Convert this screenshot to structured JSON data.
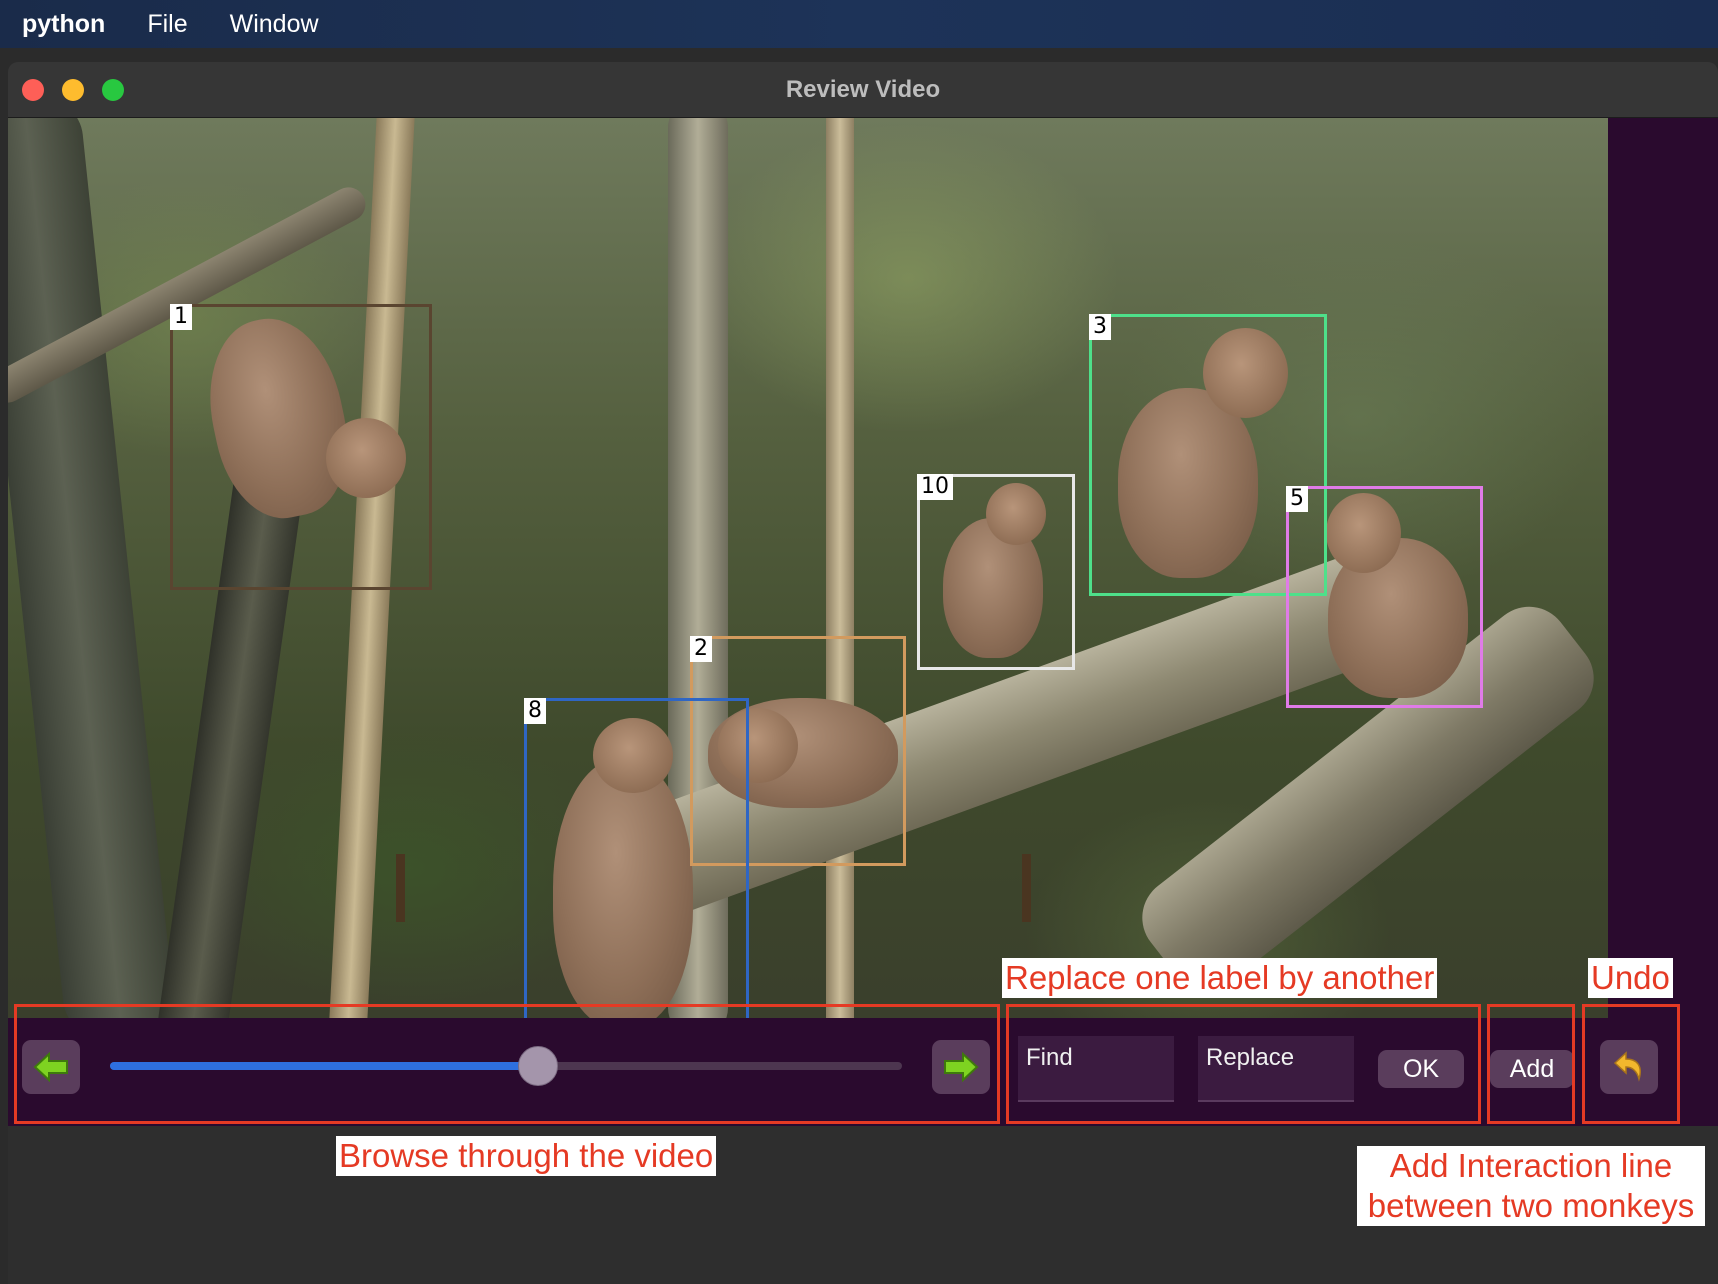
{
  "menubar": {
    "app_name": "python",
    "items": [
      "File",
      "Window"
    ]
  },
  "window": {
    "title": "Review Video"
  },
  "video": {
    "detections": [
      {
        "label": "1",
        "color": "#5a4530"
      },
      {
        "label": "2",
        "color": "#d29a5e"
      },
      {
        "label": "3",
        "color": "#4ee08a"
      },
      {
        "label": "5",
        "color": "#e07be8"
      },
      {
        "label": "8",
        "color": "#2f66c4"
      },
      {
        "label": "10",
        "color": "#e8e8e8"
      }
    ]
  },
  "controls": {
    "prev_icon": "left-arrow-icon",
    "next_icon": "right-arrow-icon",
    "slider_position": 0.54,
    "find_placeholder": "Find",
    "replace_placeholder": "Replace",
    "ok_label": "OK",
    "add_label": "Add",
    "undo_icon": "undo-icon"
  },
  "annotations": {
    "browse": "Browse through the video",
    "replace": "Replace one label by another",
    "undo": "Undo",
    "add_interaction": "Add Interaction line between two monkeys",
    "color": "#e53a24"
  }
}
